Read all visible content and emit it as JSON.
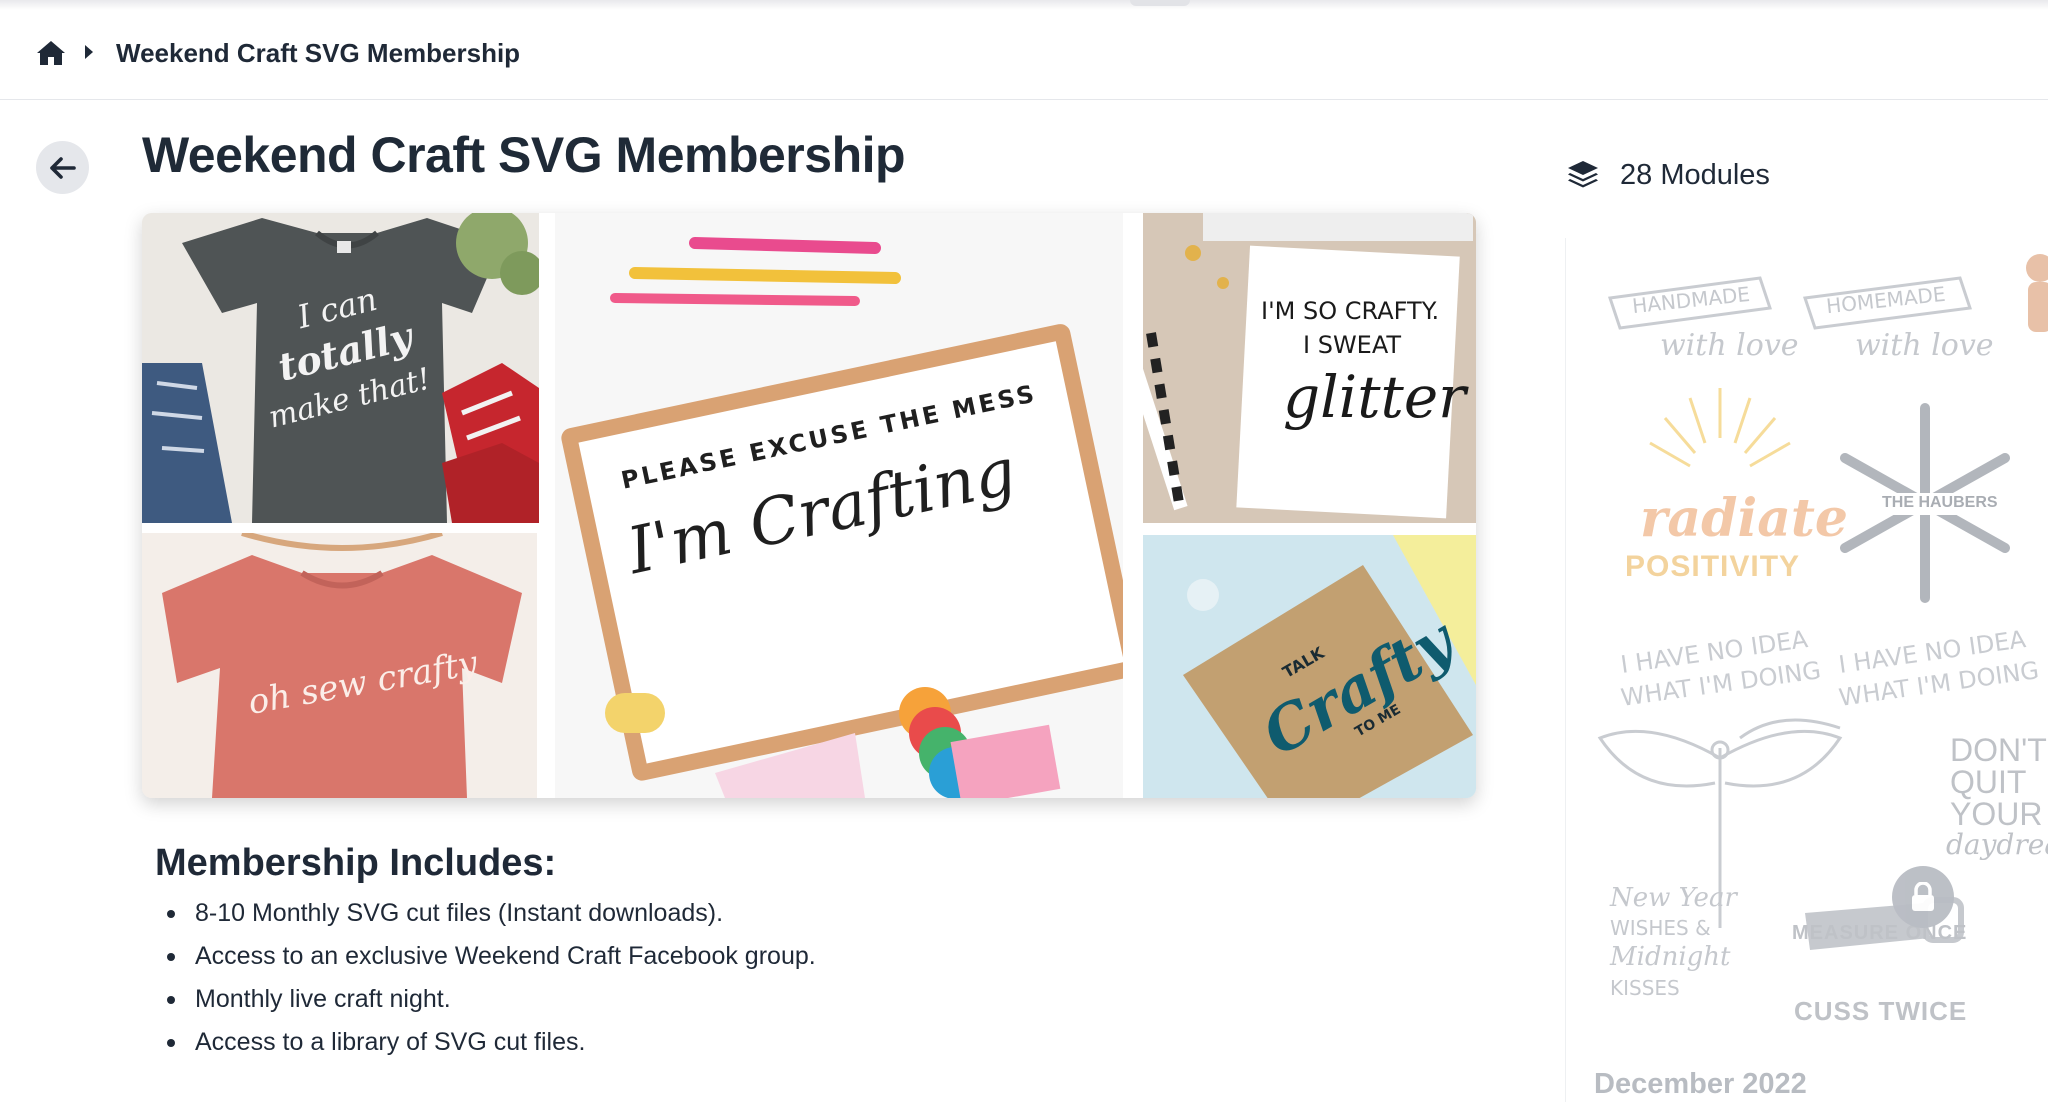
{
  "breadcrumb": {
    "home_icon": "home-icon",
    "separator_icon": "caret-right-icon",
    "current": "Weekend Craft SVG Membership"
  },
  "page": {
    "back_icon": "arrow-left-icon",
    "title": "Weekend Craft SVG Membership"
  },
  "hero": {
    "tiles": [
      {
        "name": "gray-tshirt",
        "text": [
          "I can",
          "totally",
          "make that!"
        ]
      },
      {
        "name": "pink-tshirt",
        "text": [
          "oh sew crafty"
        ]
      },
      {
        "name": "clipboard",
        "text": [
          "PLEASE EXCUSE THE MESS",
          "I'm Crafting"
        ]
      },
      {
        "name": "glitter-card",
        "text": [
          "I'M SO CRAFTY.",
          "I SWEAT",
          "glitter"
        ]
      },
      {
        "name": "kraft-notebook",
        "text": [
          "TALK",
          "Crafty",
          "TO ME"
        ]
      }
    ]
  },
  "includes": {
    "title": "Membership Includes:",
    "items": [
      "8-10 Monthly SVG cut files (Instant downloads).",
      "Access to an exclusive Weekend Craft Facebook group.",
      "Monthly live craft night.",
      "Access to a library of SVG cut files."
    ]
  },
  "sidebar": {
    "modules_icon": "layers-icon",
    "modules_count": "28 Modules",
    "module": {
      "title": "December 2022",
      "lock_icon": "lock-icon",
      "thumbnail_text": {
        "handmade": [
          "HANDMADE",
          "with love"
        ],
        "homemade": [
          "HOMEMADE",
          "with love"
        ],
        "radiate": [
          "radiate",
          "POSITIVITY"
        ],
        "haubers": "THE HAUBERS",
        "no_idea": [
          "I HAVE NO IDEA",
          "WHAT I'M DOING"
        ],
        "dont_quit": [
          "DON'T",
          "QUIT",
          "YOUR",
          "daydream"
        ],
        "new_year": [
          "New Year",
          "WISHES &",
          "Midnight",
          "KISSES"
        ],
        "measure": [
          "MEASURE ONCE",
          "CUSS TWICE"
        ]
      }
    }
  },
  "colors": {
    "text": "#1f2937",
    "muted": "#b8bcc2",
    "button_bg": "#e5e7eb",
    "accent_teal": "#0f5b6e"
  }
}
